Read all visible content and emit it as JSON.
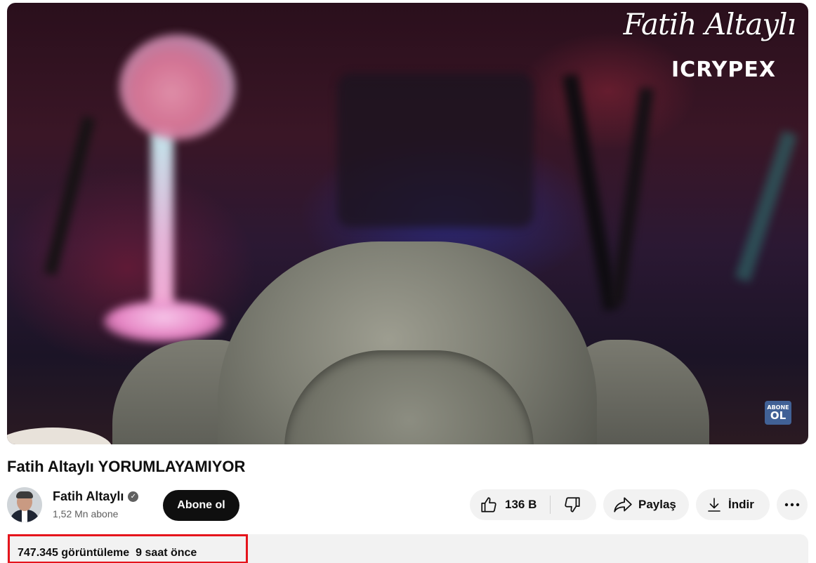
{
  "video": {
    "watermark_signature": "Fatih Altaylı",
    "watermark_brand": "ICRYPEX",
    "subscribe_badge_line1": "ABONE",
    "subscribe_badge_line2": "OL"
  },
  "title": "Fatih Altaylı YORUMLAYAMIYOR",
  "channel": {
    "name": "Fatih Altaylı",
    "verified_icon": "check-circle",
    "subscribers": "1,52 Mn abone"
  },
  "subscribe_label": "Abone ol",
  "actions": {
    "like_count": "136 B",
    "share_label": "Paylaş",
    "download_label": "İndir"
  },
  "description": {
    "views": "747.345 görüntüleme",
    "uploaded": "9 saat önce"
  },
  "colors": {
    "highlight_border": "#e5141c",
    "button_dark": "#0f0f0f",
    "pill_bg": "#f2f2f2"
  }
}
